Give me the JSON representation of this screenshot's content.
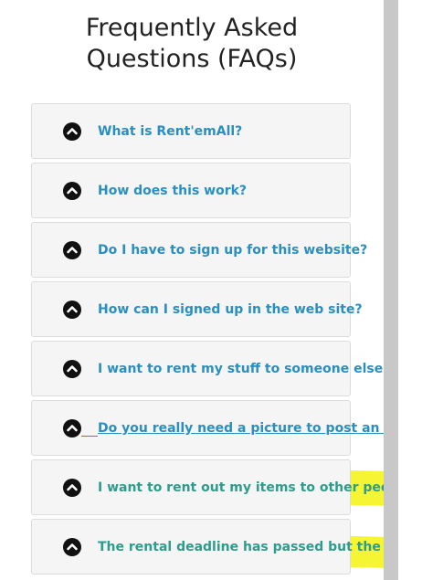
{
  "page": {
    "title": "Frequently Asked Questions (FAQs)"
  },
  "faq": {
    "icon": "chevron-up-circle-icon",
    "items": [
      {
        "question": "What is Rent'emAll?"
      },
      {
        "question": "How does this work?"
      },
      {
        "question": "Do I have to sign up for this website?"
      },
      {
        "question": "How can I signed up in the web site?"
      },
      {
        "question": "I want to rent my stuff to someone else. How"
      },
      {
        "question": "Do you really need a picture to post an ad?"
      },
      {
        "question": "I want to rent out my items to other people"
      },
      {
        "question": "The rental deadline has passed but the borro"
      }
    ]
  },
  "colors": {
    "link": "#2a8fbf",
    "highlight": "#f4f41e",
    "panel": "#f5f5f5",
    "scrollbar": "#c8c8c8"
  }
}
